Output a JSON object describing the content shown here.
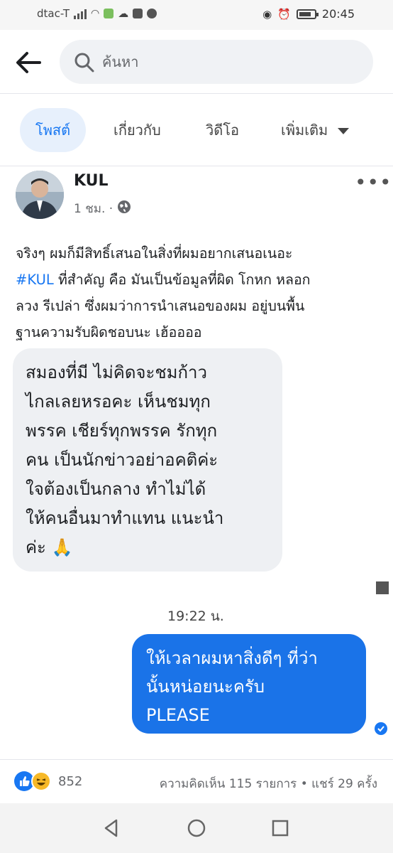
{
  "status_bar": {
    "carrier": "dtac-T",
    "time": "20:45",
    "icons": [
      "signal-icon",
      "wifi-icon",
      "app-icon",
      "cloud-icon",
      "shop-icon",
      "line-icon",
      "eye-icon",
      "alarm-icon",
      "battery-icon"
    ]
  },
  "search": {
    "placeholder": "ค้นหา"
  },
  "tabs": [
    {
      "label": "โพสต์",
      "active": true
    },
    {
      "label": "เกี่ยวกับ",
      "active": false
    },
    {
      "label": "วิดีโอ",
      "active": false
    },
    {
      "label": "เพิ่มเติม",
      "active": false
    }
  ],
  "post": {
    "author": "KUL",
    "time": "1 ชม. ·",
    "body_lines": [
      "จริงๆ ผมก็มีสิทธิ์เสนอในสิ่งที่ผมอยากเสนอเนอะ",
      "ที่สำคัญ คือ มันเป็นข้อมูลที่ผิด โกหก หลอก",
      "ลวง รีเปล่า ซึ่งผมว่าการนำเสนอของผม อยู่บนพื้น",
      "ฐานความรับผิดชอบนะ เฮ้ออออ"
    ],
    "hashtag": "#KUL"
  },
  "chat": {
    "incoming_lines": [
      "สมองที่มี ไม่คิดจะชมก้าว",
      "ไกลเลยหรอคะ เห็นชมทุก",
      "พรรค เชียร์ทุกพรรค รักทุก",
      "คน เป็นนักข่าวอย่าอคติค่ะ",
      "ใจต้องเป็นกลาง ทำไม่ได้",
      "ให้คนอื่นมาทำแทน แนะนำ",
      "ค่ะ 🙏"
    ],
    "timestamp": "19:22 น.",
    "outgoing_lines": [
      "ให้เวลาผมหาสิ่งดีๆ ที่ว่า",
      "นั้นหน่อยนะครับ",
      "PLEASE"
    ]
  },
  "footer": {
    "reaction_count": "852",
    "stats": "ความคิดเห็น 115 รายการ • แชร์ 29 ครั้ง"
  },
  "colors": {
    "accent": "#1877f2",
    "bubble_out": "#1a73e8",
    "bubble_in": "#eef0f3"
  }
}
